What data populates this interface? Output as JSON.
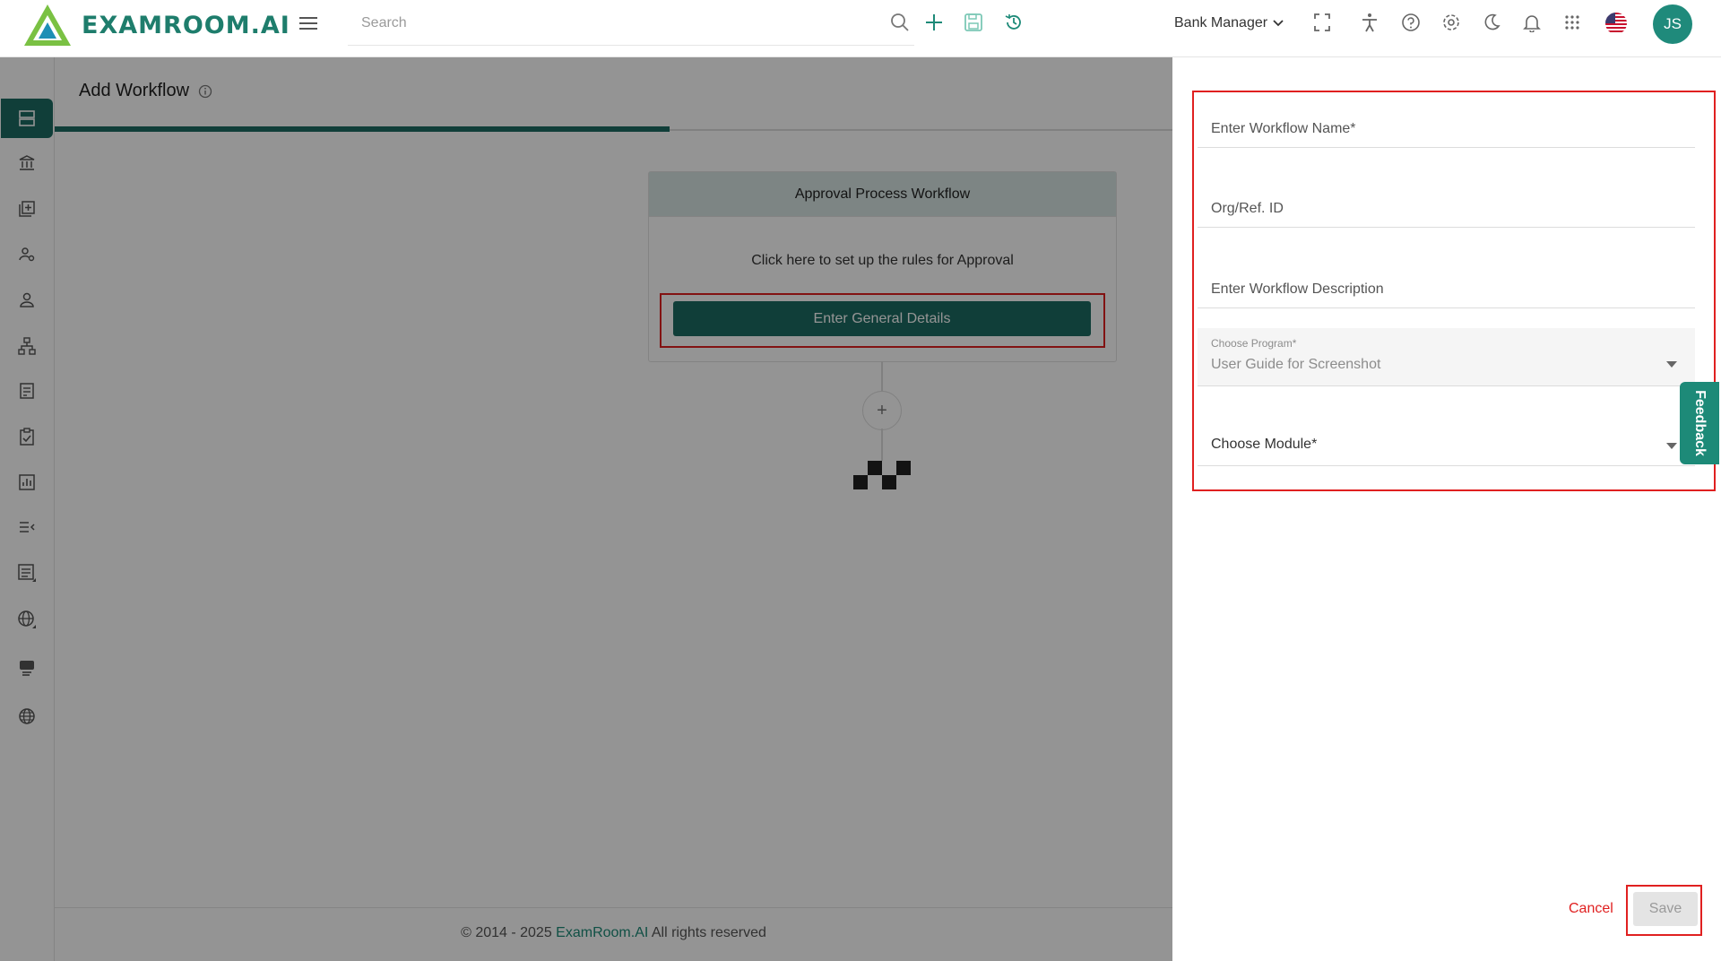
{
  "header": {
    "logo_text": "EXAMROOM.AI",
    "search_placeholder": "Search",
    "role": "Bank Manager",
    "avatar_initials": "JS"
  },
  "main": {
    "page_title": "Add Workflow",
    "progress_fraction": 0.55,
    "workflow_card": {
      "title": "Approval Process Workflow",
      "text": "Click here to set up the rules for Approval",
      "button_label": "Enter General Details"
    },
    "add_node_label": "+",
    "footer": {
      "copyright": "© 2014 - 2025",
      "brand": "ExamRoom.AI",
      "rights": "All rights reserved"
    }
  },
  "panel": {
    "workflow_name_placeholder": "Enter Workflow Name*",
    "org_ref_placeholder": "Org/Ref. ID",
    "description_placeholder": "Enter Workflow Description",
    "program_label": "Choose Program*",
    "program_value": "User Guide for Screenshot",
    "module_placeholder": "Choose Module*",
    "feedback_label": "Feedback",
    "cancel_label": "Cancel",
    "save_label": "Save"
  },
  "colors": {
    "brand_teal": "#1d6b62",
    "accent_teal": "#1d8a78",
    "highlight_red": "#e02020"
  }
}
